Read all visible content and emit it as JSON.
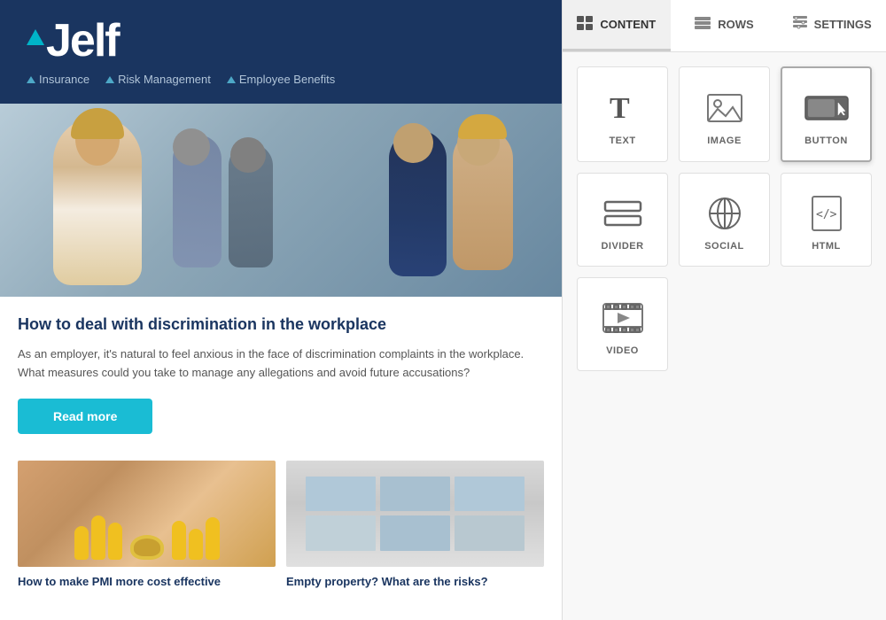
{
  "left_panel": {
    "header": {
      "logo_text": "Jelf",
      "nav_items": [
        {
          "label": "Insurance"
        },
        {
          "label": "Risk Management"
        },
        {
          "label": "Employee Benefits"
        }
      ]
    },
    "main_article": {
      "title": "How to deal with discrimination in the workplace",
      "body": "As an employer, it's natural to feel anxious in the face of discrimination complaints in the workplace. What measures could you take to manage any allegations and avoid future accusations?",
      "read_more_label": "Read more"
    },
    "sub_articles": [
      {
        "title": "How to make PMI more cost effective"
      },
      {
        "title": "Empty property? What are the risks?"
      }
    ]
  },
  "right_panel": {
    "tabs": [
      {
        "label": "CONTENT",
        "id": "content",
        "active": true
      },
      {
        "label": "ROWS",
        "id": "rows",
        "active": false
      },
      {
        "label": "SETTINGS",
        "id": "settings",
        "active": false
      }
    ],
    "content_items": [
      {
        "id": "text",
        "label": "TEXT"
      },
      {
        "id": "image",
        "label": "IMAGE"
      },
      {
        "id": "button",
        "label": "BUTTON",
        "active": true
      },
      {
        "id": "divider",
        "label": "DIVIDER"
      },
      {
        "id": "social",
        "label": "SOCIAL"
      },
      {
        "id": "html",
        "label": "HTML"
      },
      {
        "id": "video",
        "label": "VIDEO"
      }
    ]
  },
  "colors": {
    "brand_dark": "#1a3560",
    "brand_teal": "#1abcd4",
    "bg_light": "#f8f8f8",
    "border": "#e0e0e0"
  }
}
